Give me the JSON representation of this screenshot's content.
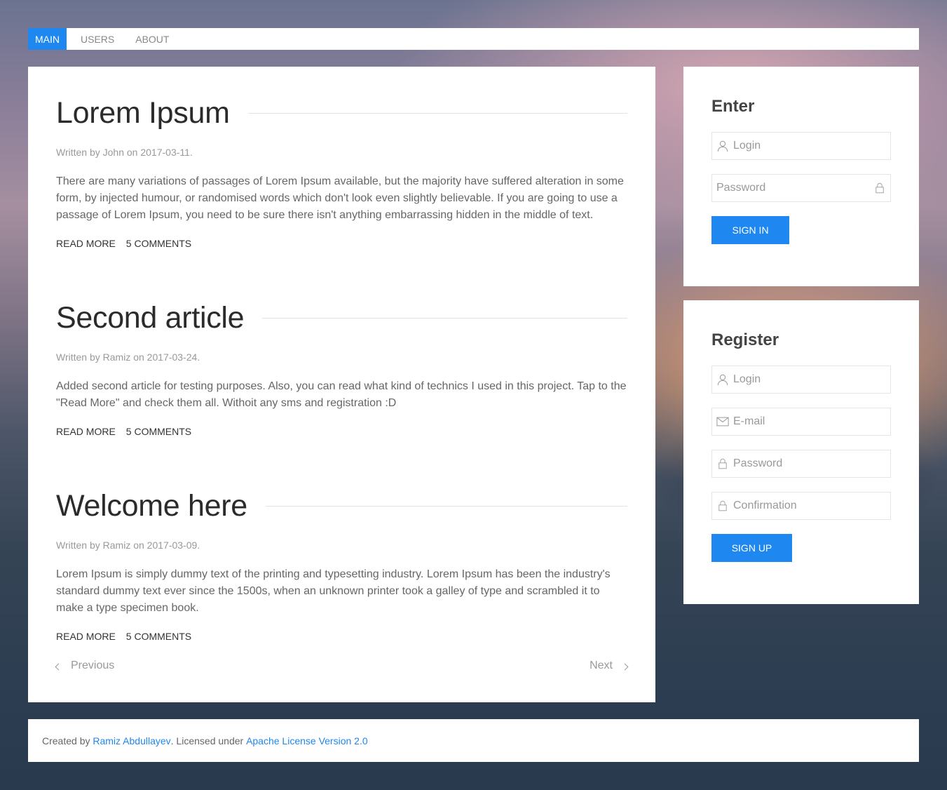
{
  "nav": {
    "items": [
      {
        "label": "MAIN",
        "active": true
      },
      {
        "label": "USERS",
        "active": false
      },
      {
        "label": "ABOUT",
        "active": false
      }
    ]
  },
  "articles": [
    {
      "title": "Lorem Ipsum",
      "meta": "Written by John on 2017-03-11.",
      "body": "There are many variations of passages of Lorem Ipsum available, but the majority have suffered alteration in some form, by injected humour, or randomised words which don't look even slightly believable. If you are going to use a passage of Lorem Ipsum, you need to be sure there isn't anything embarrassing hidden in the middle of text.",
      "read_more": "READ MORE",
      "comments": "5 COMMENTS"
    },
    {
      "title": "Second article",
      "meta": "Written by Ramiz on 2017-03-24.",
      "body": "Added second article for testing purposes. Also, you can read what kind of technics I used in this project. Tap to the \"Read More\" and check them all. Withoit any sms and registration :D",
      "read_more": "READ MORE",
      "comments": "5 COMMENTS"
    },
    {
      "title": "Welcome here",
      "meta": "Written by Ramiz on 2017-03-09.",
      "body": "Lorem Ipsum is simply dummy text of the printing and typesetting industry. Lorem Ipsum has been the industry's standard dummy text ever since the 1500s, when an unknown printer took a galley of type and scrambled it to make a type specimen book.",
      "read_more": "READ MORE",
      "comments": "5 COMMENTS"
    }
  ],
  "pagination": {
    "previous": "Previous",
    "next": "Next"
  },
  "enter": {
    "title": "Enter",
    "login_placeholder": "Login",
    "password_placeholder": "Password",
    "submit": "SIGN IN"
  },
  "register": {
    "title": "Register",
    "login_placeholder": "Login",
    "email_placeholder": "E-mail",
    "password_placeholder": "Password",
    "confirmation_placeholder": "Confirmation",
    "submit": "SIGN UP"
  },
  "footer": {
    "created_by": "Created by ",
    "author": "Ramiz Abdullayev",
    "licensed": ". Licensed under ",
    "license": "Apache License Version 2.0"
  },
  "colors": {
    "accent": "#1e87f0",
    "text_dark": "#2b2b2b",
    "text_muted": "#999999"
  },
  "icons": {
    "user": "user-icon",
    "lock": "lock-icon",
    "mail": "mail-icon",
    "chevron_left": "chevron-left-icon",
    "chevron_right": "chevron-right-icon"
  }
}
